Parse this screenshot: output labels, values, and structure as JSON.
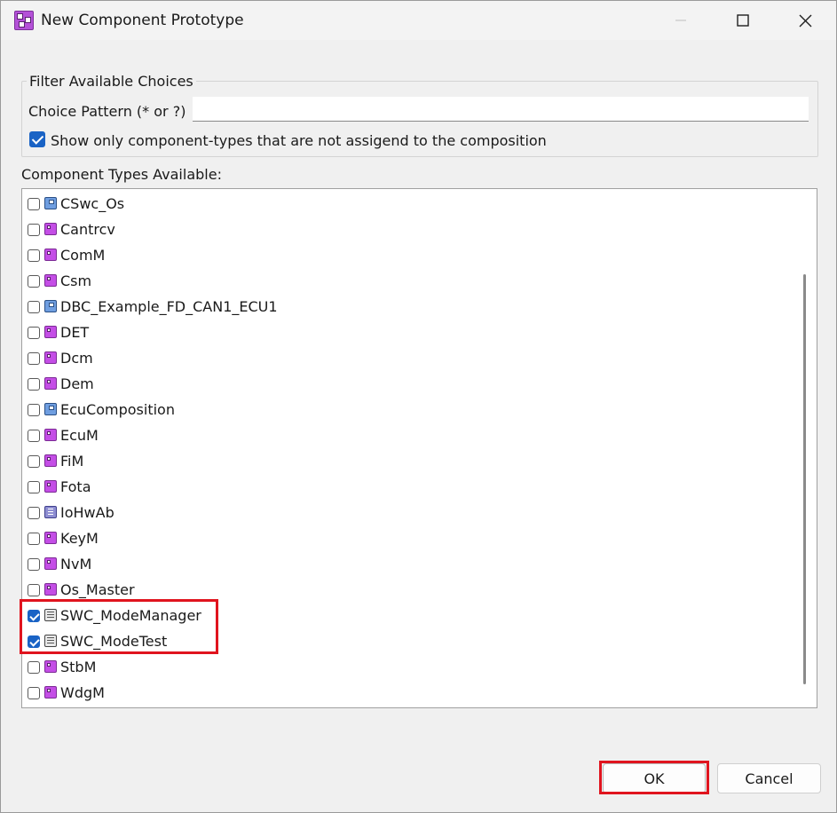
{
  "window": {
    "title": "New Component Prototype",
    "accent_color": "#1a63c5",
    "highlight_color": "#e0141e"
  },
  "filter": {
    "legend": "Filter Available Choices",
    "pattern_label": "Choice Pattern (* or ?)",
    "pattern_value": "",
    "show_only_label": "Show only component-types that are not assigend to the composition",
    "show_only_checked": true
  },
  "list": {
    "label": "Component Types Available:",
    "items": [
      {
        "name": "CSwc_Os",
        "icon": "composition-icon",
        "checked": false
      },
      {
        "name": "Cantrcv",
        "icon": "swc-icon",
        "checked": false
      },
      {
        "name": "ComM",
        "icon": "swc-icon",
        "checked": false
      },
      {
        "name": "Csm",
        "icon": "swc-icon",
        "checked": false
      },
      {
        "name": "DBC_Example_FD_CAN1_ECU1",
        "icon": "composition-icon",
        "checked": false
      },
      {
        "name": "DET",
        "icon": "swc-icon",
        "checked": false
      },
      {
        "name": "Dcm",
        "icon": "swc-icon",
        "checked": false
      },
      {
        "name": "Dem",
        "icon": "swc-icon",
        "checked": false
      },
      {
        "name": "EcuComposition",
        "icon": "composition-icon",
        "checked": false
      },
      {
        "name": "EcuM",
        "icon": "swc-icon",
        "checked": false
      },
      {
        "name": "FiM",
        "icon": "swc-icon",
        "checked": false
      },
      {
        "name": "Fota",
        "icon": "swc-icon",
        "checked": false
      },
      {
        "name": "IoHwAb",
        "icon": "iohwab-icon",
        "checked": false
      },
      {
        "name": "KeyM",
        "icon": "swc-icon",
        "checked": false
      },
      {
        "name": "NvM",
        "icon": "swc-icon",
        "checked": false
      },
      {
        "name": "Os_Master",
        "icon": "swc-icon",
        "checked": false
      },
      {
        "name": "SWC_ModeManager",
        "icon": "application-swc-icon",
        "checked": true
      },
      {
        "name": "SWC_ModeTest",
        "icon": "application-swc-icon",
        "checked": true
      },
      {
        "name": "StbM",
        "icon": "swc-icon",
        "checked": false
      },
      {
        "name": "WdgM",
        "icon": "swc-icon",
        "checked": false
      }
    ]
  },
  "buttons": {
    "ok": "OK",
    "cancel": "Cancel"
  }
}
